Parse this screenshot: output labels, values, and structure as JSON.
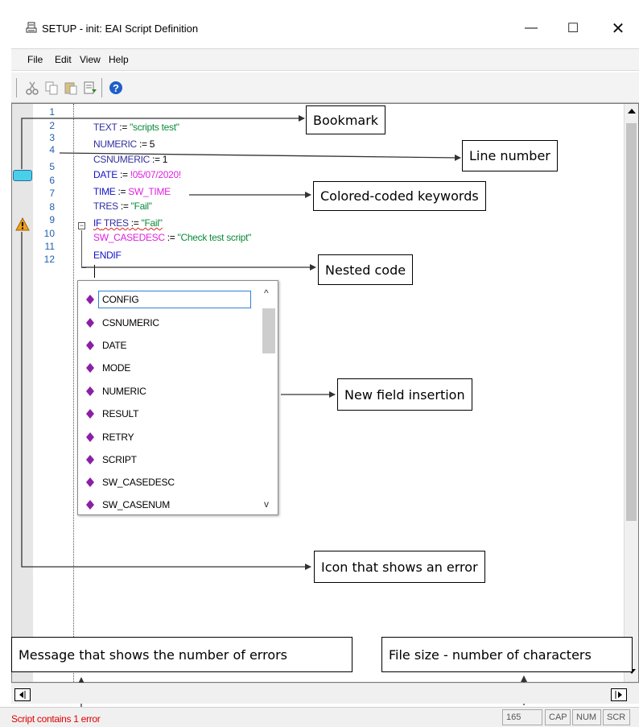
{
  "window": {
    "title": "SETUP - init: EAI Script Definition",
    "minimize_glyph": "—",
    "maximize_glyph": "☐",
    "close_glyph": "✕"
  },
  "menu": [
    "File",
    "Edit",
    "View",
    "Help"
  ],
  "toolbar": {
    "icons": [
      "cut-icon",
      "copy-icon",
      "paste-icon",
      "insert-field-icon",
      "help-icon"
    ]
  },
  "editor": {
    "line_numbers": [
      "1",
      "2",
      "3",
      "4",
      "5",
      "6",
      "7",
      "8",
      "9",
      "10",
      "11",
      "12"
    ],
    "lines": {
      "l2_name": "TEXT",
      "l2_op": " := ",
      "l2_val": "\"scripts test\"",
      "l3_name": "NUMERIC",
      "l3_op": " := 5",
      "l4_name": "CSNUMERIC",
      "l4_op": " := 1",
      "l5_name": "DATE",
      "l5_op": " := ",
      "l5_val": "!05/07/2020!",
      "l6_name": "TIME",
      "l6_op": " := ",
      "l6_val": "SW_TIME",
      "l7_name": "TRES",
      "l7_op": " := ",
      "l7_val": "\"Fail\"",
      "l8_kw": "IF",
      "l8_name": " TRES",
      "l8_op": " := ",
      "l8_val": "\"Fail\"",
      "l9_name": "SW_CASEDESC",
      "l9_op": " := ",
      "l9_val": "\"Check test script\"",
      "l10_kw": "ENDIF"
    },
    "fold_glyph": "−"
  },
  "autocomplete": {
    "items": [
      "CONFIG",
      "CSNUMERIC",
      "DATE",
      "MODE",
      "NUMERIC",
      "RESULT",
      "RETRY",
      "SCRIPT",
      "SW_CASEDESC",
      "SW_CASENUM"
    ],
    "selected": "CONFIG",
    "scroll_up": "^",
    "scroll_down": "v"
  },
  "annotations": {
    "bookmark": "Bookmark",
    "line_number": "Line number",
    "colored_keywords": "Colored-coded keywords",
    "nested_code": "Nested code",
    "new_field": "New field insertion",
    "error_icon": "Icon that shows an error",
    "error_message": "Message that shows the number of errors",
    "file_size": "File size - number of characters"
  },
  "status": {
    "message": "Script contains 1 error",
    "char_count": "165",
    "cap": "CAP",
    "num": "NUM",
    "scr": "SCR"
  },
  "colors": {
    "keyword": "#1212c8",
    "string": "#0a8a3a",
    "system_field": "#e020e0",
    "error_text": "#e00000",
    "bookmark": "#48d0e8",
    "field_diamond": "#8b1fa8"
  }
}
